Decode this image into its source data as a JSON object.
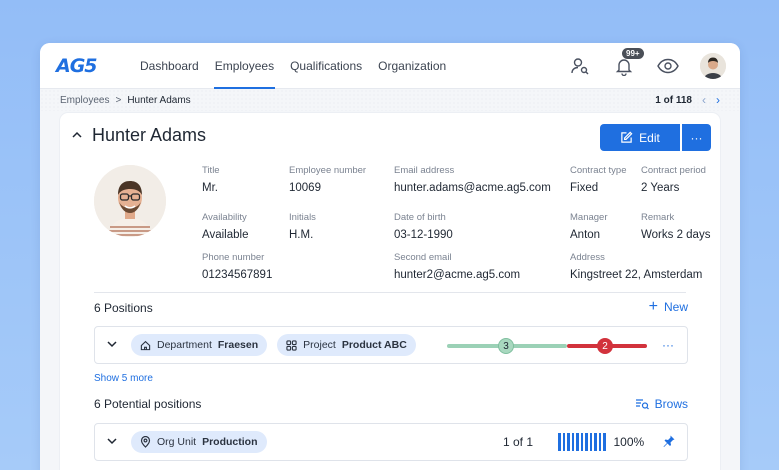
{
  "app": {
    "logo": "AG5"
  },
  "nav": [
    {
      "label": "Dashboard",
      "active": false
    },
    {
      "label": "Employees",
      "active": true
    },
    {
      "label": "Qualifications",
      "active": false
    },
    {
      "label": "Organization",
      "active": false
    }
  ],
  "topbar": {
    "notifications_badge": "99+"
  },
  "breadcrumb": {
    "root": "Employees",
    "separator": ">",
    "current": "Hunter Adams"
  },
  "pager": {
    "text": "1 of 118"
  },
  "person": {
    "name": "Hunter Adams",
    "edit_label": "Edit",
    "more_label": "···",
    "fields": {
      "title": {
        "label": "Title",
        "value": "Mr."
      },
      "employee_number": {
        "label": "Employee number",
        "value": "10069"
      },
      "email": {
        "label": "Email address",
        "value": "hunter.adams@acme.ag5.com"
      },
      "contract_type": {
        "label": "Contract type",
        "value": "Fixed"
      },
      "contract_period": {
        "label": "Contract period",
        "value": "2 Years"
      },
      "availability": {
        "label": "Availability",
        "value": "Available"
      },
      "initials": {
        "label": "Initials",
        "value": "H.M."
      },
      "dob": {
        "label": "Date of birth",
        "value": "03-12-1990"
      },
      "manager": {
        "label": "Manager",
        "value": "Anton"
      },
      "remark": {
        "label": "Remark",
        "value": "Works 2 days"
      },
      "phone": {
        "label": "Phone number",
        "value": "01234567891"
      },
      "second_email": {
        "label": "Second email",
        "value": "hunter2@acme.ag5.com"
      },
      "address": {
        "label": "Address",
        "value": "Kingstreet 22, Amsterdam"
      }
    }
  },
  "positions": {
    "title": "6 Positions",
    "action": "New",
    "row": {
      "chip1_label": "Department",
      "chip1_value": "Fraesen",
      "chip2_label": "Project",
      "chip2_value": "Product ABC",
      "green_count": "3",
      "red_count": "2",
      "more": "···"
    },
    "show_more": "Show 5 more"
  },
  "potential": {
    "title": "6 Potential positions",
    "action": "Brows",
    "row": {
      "chip_label": "Org Unit",
      "chip_value": "Production",
      "count_text": "1 of 1",
      "coverage": "100%"
    }
  },
  "colors": {
    "accent": "#1f6fe0",
    "green": "#8fcfb0",
    "red": "#d2323c"
  }
}
